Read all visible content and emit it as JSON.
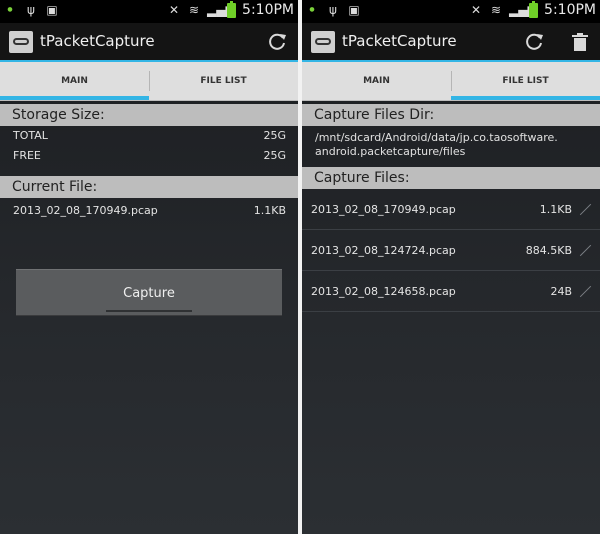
{
  "time": "5:10PM",
  "app_title": "tPacketCapture",
  "tabs": [
    "MAIN",
    "FILE LIST"
  ],
  "main": {
    "storage_header": "Storage Size:",
    "storage": [
      {
        "label": "TOTAL",
        "value": "25G"
      },
      {
        "label": "FREE",
        "value": "25G"
      }
    ],
    "current_header": "Current File:",
    "current_file": {
      "name": "2013_02_08_170949.pcap",
      "size": "1.1KB"
    },
    "capture_label": "Capture"
  },
  "file_list": {
    "dir_header": "Capture Files Dir:",
    "dir_path": "/mnt/sdcard/Android/data/jp.co.taosoftware.\nandroid.packetcapture/files",
    "files_header": "Capture Files:",
    "files": [
      {
        "name": "2013_02_08_170949.pcap",
        "size": "1.1KB"
      },
      {
        "name": "2013_02_08_124724.pcap",
        "size": "884.5KB"
      },
      {
        "name": "2013_02_08_124658.pcap",
        "size": "24B"
      }
    ]
  },
  "colors": {
    "accent": "#33b5e5",
    "battery": "#6fcf28",
    "header_bg": "#bdbdbd",
    "tab_bg": "#dedede"
  },
  "icons": [
    "usb-icon",
    "photo-icon",
    "mute-icon",
    "wifi-icon",
    "signal-icon",
    "battery-icon",
    "refresh-icon",
    "trash-icon"
  ]
}
